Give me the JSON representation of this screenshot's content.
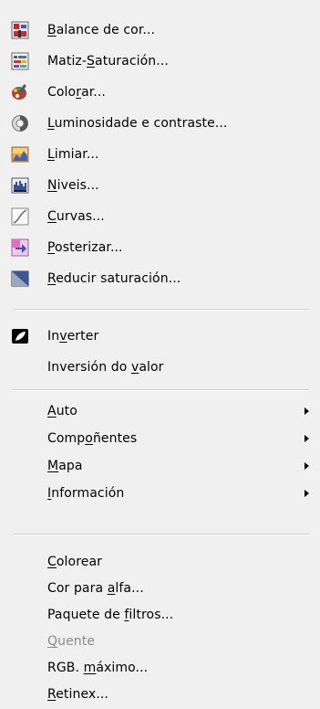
{
  "menu": {
    "items": [
      {
        "pre": "",
        "u": "B",
        "post": "alance de cor...",
        "icon": "color-balance-icon"
      },
      {
        "pre": "Matiz-",
        "u": "S",
        "post": "aturación...",
        "icon": "hue-saturation-icon"
      },
      {
        "pre": "Colo",
        "u": "r",
        "post": "ar...",
        "icon": "colorize-icon"
      },
      {
        "pre": "",
        "u": "L",
        "post": "uminosidade e contraste...",
        "icon": "brightness-contrast-icon"
      },
      {
        "pre": "",
        "u": "L",
        "post": "imiar...",
        "icon": "threshold-icon"
      },
      {
        "pre": "",
        "u": "N",
        "post": "iveis...",
        "icon": "levels-icon"
      },
      {
        "pre": "",
        "u": "C",
        "post": "urvas...",
        "icon": "curves-icon"
      },
      {
        "pre": "",
        "u": "P",
        "post": "osterizar...",
        "icon": "posterize-icon"
      },
      {
        "pre": "",
        "u": "R",
        "post": "educir saturación...",
        "icon": "desaturate-icon"
      }
    ],
    "invert": [
      {
        "pre": "In",
        "u": "v",
        "post": "erter",
        "icon": "invert-icon"
      },
      {
        "pre": "Inversión do ",
        "u": "v",
        "post": "alor"
      }
    ],
    "submenus": [
      {
        "pre": "",
        "u": "A",
        "post": "uto"
      },
      {
        "pre": "Comp",
        "u": "o",
        "post": "ñentes"
      },
      {
        "pre": "",
        "u": "M",
        "post": "apa"
      },
      {
        "pre": "",
        "u": "I",
        "post": "nformación"
      }
    ],
    "filters": [
      {
        "pre": "",
        "u": "C",
        "post": "olorear",
        "disabled": false
      },
      {
        "pre": "Cor para ",
        "u": "a",
        "post": "lfa...",
        "disabled": false
      },
      {
        "pre": "Paquete de ",
        "u": "f",
        "post": "iltros...",
        "disabled": false
      },
      {
        "pre": "",
        "u": "Q",
        "post": "uente",
        "disabled": true
      },
      {
        "pre": "RGB. ",
        "u": "m",
        "post": "áximo...",
        "disabled": false
      },
      {
        "pre": "",
        "u": "R",
        "post": "etinex...",
        "disabled": false
      }
    ]
  }
}
